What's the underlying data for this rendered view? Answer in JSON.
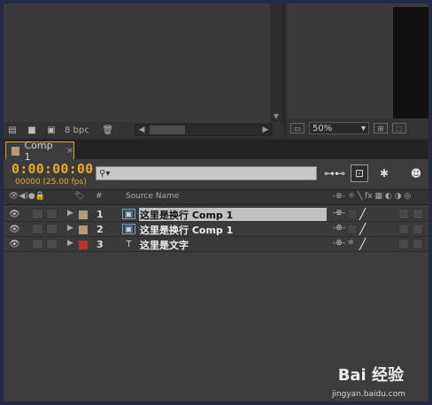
{
  "project_panel": {
    "bpc_label": "8 bpc",
    "icons": [
      "interpret-footage-icon",
      "folder-icon",
      "new-comp-icon",
      "trash-icon"
    ]
  },
  "viewer": {
    "zoom_value": "50%"
  },
  "timeline": {
    "tab_label": "Comp 1",
    "tab_close": "×",
    "timecode": "0:00:00:00",
    "frame_info": "00000 (25.00 fps)",
    "search_placeholder": "",
    "header": {
      "hash": "#",
      "source_name": "Source Name"
    },
    "layers": [
      {
        "num": "1",
        "name": "这里是换行 Comp 1",
        "label_color": "#b39a7a",
        "type": "comp",
        "selected": true
      },
      {
        "num": "2",
        "name": "这里是换行 Comp 1",
        "label_color": "#b39a7a",
        "type": "comp",
        "selected": false
      },
      {
        "num": "3",
        "name": "这里是文字",
        "label_color": "#c03030",
        "type": "text",
        "selected": false
      }
    ]
  },
  "colors": {
    "timecode": "#e8a82a",
    "tab_border": "#d6a23a",
    "frame_border": "#1e2a55"
  },
  "watermark": {
    "brand": "Bai 经验",
    "url": "jingyan.baidu.com"
  }
}
